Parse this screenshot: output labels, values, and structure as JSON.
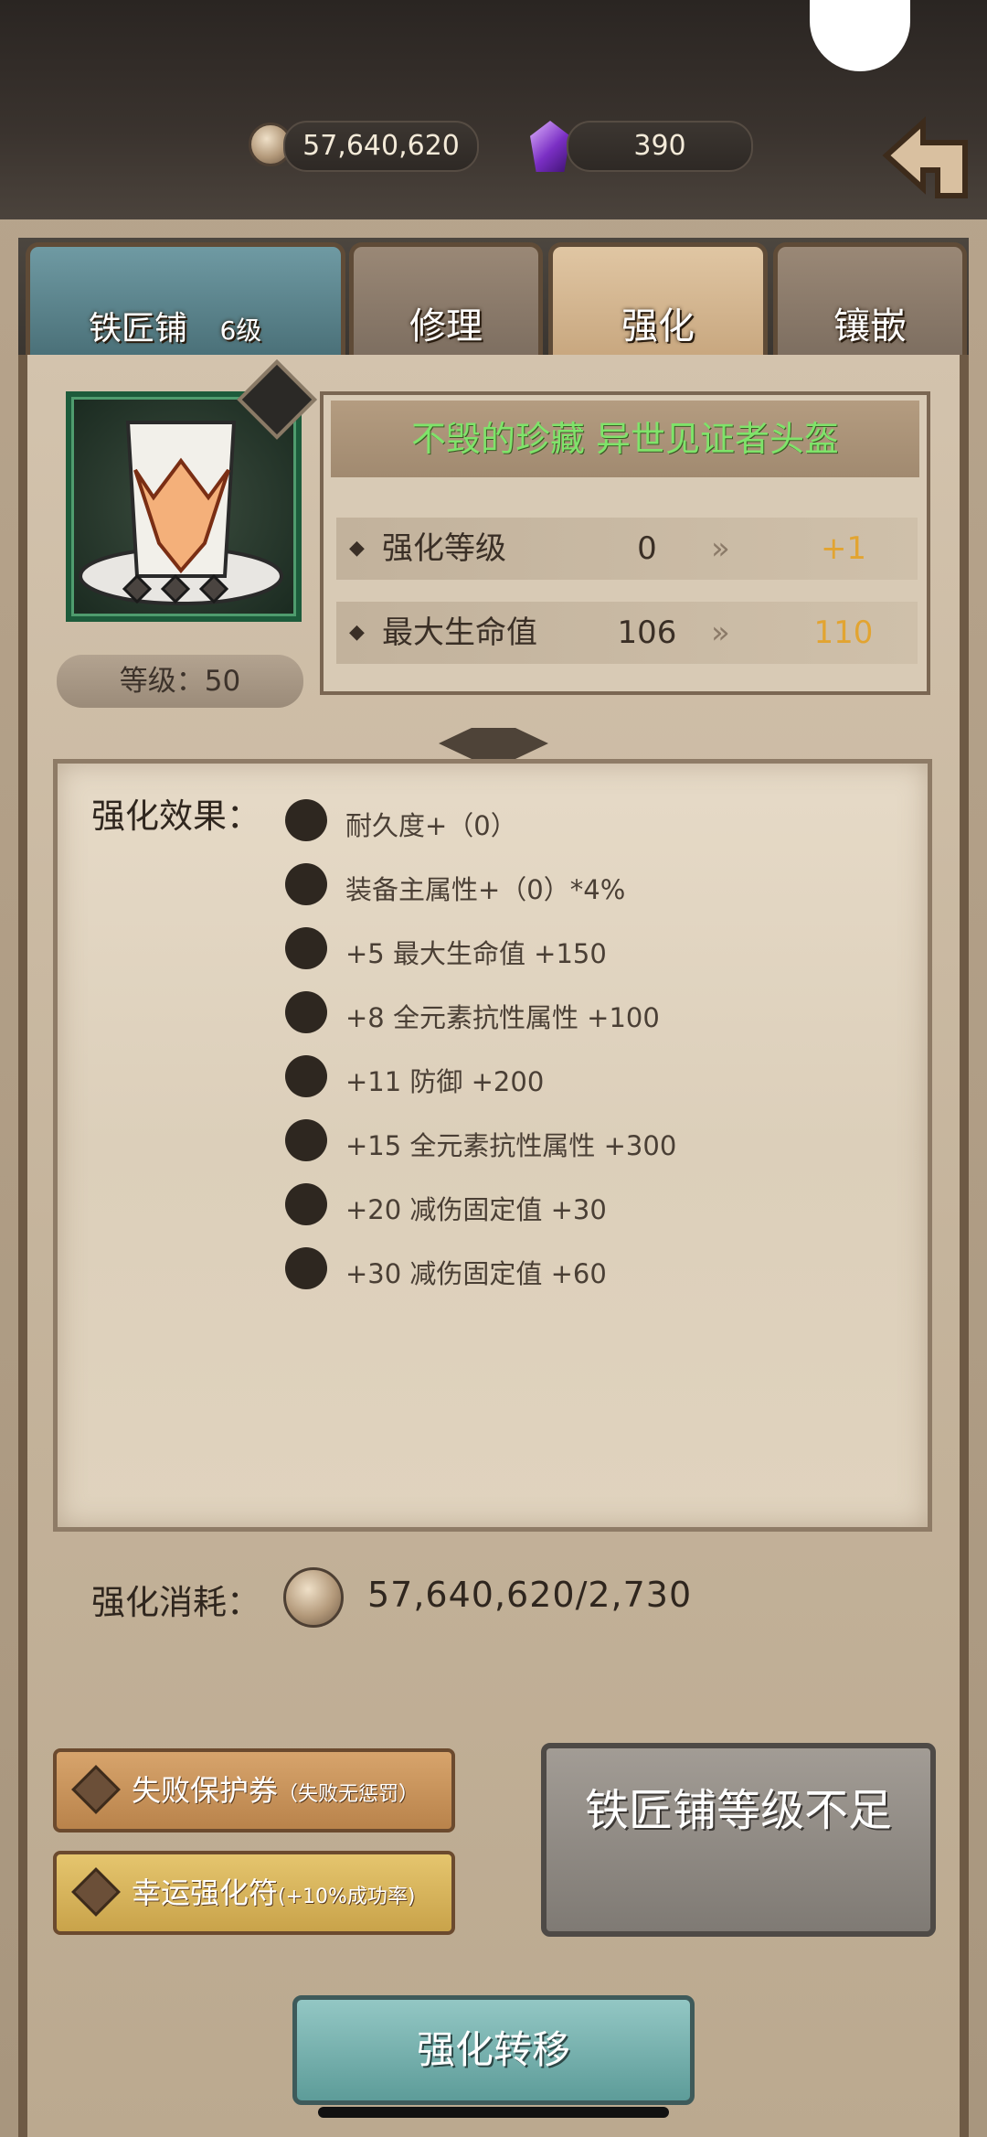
{
  "currency": {
    "coins": "57,640,620",
    "gems": "390"
  },
  "tabs": [
    {
      "label": "铁匠铺",
      "level": "6级"
    },
    {
      "label": "修理"
    },
    {
      "label": "强化"
    },
    {
      "label": "镶嵌"
    }
  ],
  "item": {
    "name": "不毁的珍藏 异世见证者头盔",
    "level_label": "等级：50",
    "stats": [
      {
        "label": "强化等级",
        "current": "0",
        "next": "+1"
      },
      {
        "label": "最大生命值",
        "current": "106",
        "next": "110"
      }
    ]
  },
  "effects": {
    "title": "强化效果：",
    "lines": [
      "耐久度+（0）",
      "装备主属性+（0）*4%",
      "+5  最大生命值 +150",
      "+8  全元素抗性属性 +100",
      "+11  防御 +200",
      "+15  全元素抗性属性 +300",
      "+20  减伤固定值 +30",
      "+30  减伤固定值 +60"
    ]
  },
  "cost": {
    "label": "强化消耗：",
    "value": "57,640,620/2,730"
  },
  "buttons": {
    "protect_label": "失败保护券",
    "protect_note": "（失败无惩罚）",
    "luck_label": "幸运强化符",
    "luck_note": "(+10%成功率)",
    "enhance_disabled": "铁匠铺等级不足",
    "transfer": "强化转移"
  },
  "colors": {
    "name_green": "#7fe36a",
    "next_orange": "#e2a431"
  }
}
